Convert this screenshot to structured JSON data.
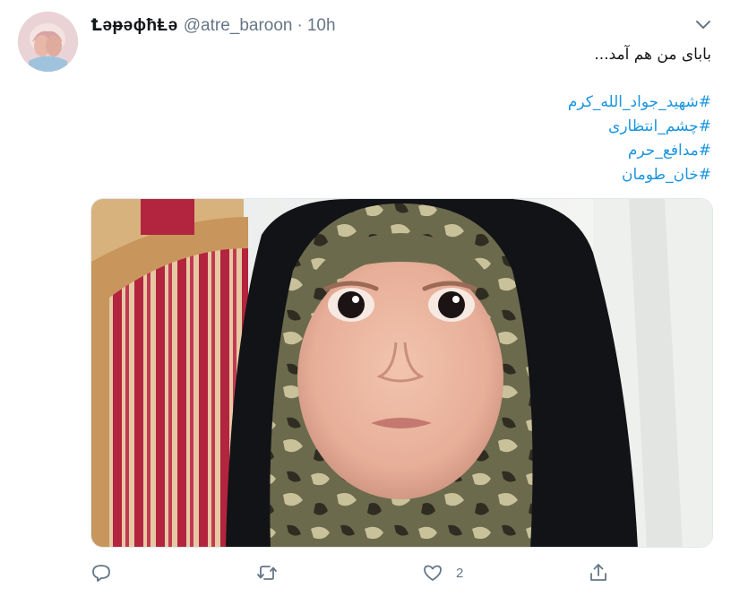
{
  "tweet": {
    "display_name": "ꝈәᵽәɸħⱠә",
    "handle": "@atre_baroon",
    "separator": "·",
    "timestamp": "10h",
    "text_line": "بابای من هم آمد...",
    "hashtags": [
      "#شهید_جواد_الله_کرم",
      "#چشم_انتظاری",
      "#مدافع_حرم",
      "#خان_طومان"
    ],
    "media_type": "photo"
  },
  "actions": {
    "reply_icon": "reply-icon",
    "retweet_icon": "retweet-icon",
    "like_icon": "heart-icon",
    "like_count": "2",
    "share_icon": "share-icon"
  },
  "colors": {
    "link": "#1b95e0",
    "muted": "#657786",
    "text": "#14171a"
  }
}
